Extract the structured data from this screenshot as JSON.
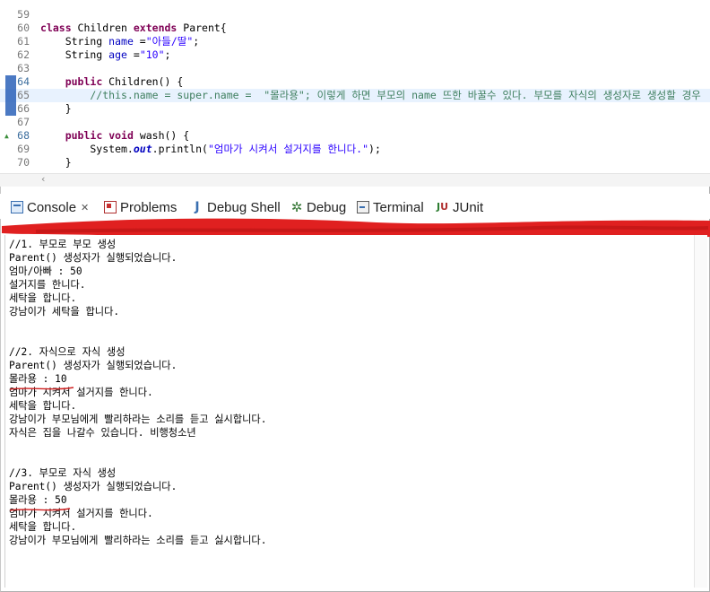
{
  "editor": {
    "lines": [
      {
        "num": "59",
        "tokens": []
      },
      {
        "num": "60",
        "tokens": [
          {
            "t": "kw",
            "v": "class"
          },
          {
            "t": "p",
            "v": " Children "
          },
          {
            "t": "kw",
            "v": "extends"
          },
          {
            "t": "p",
            "v": " Parent{"
          }
        ]
      },
      {
        "num": "61",
        "tokens": [
          {
            "t": "p",
            "v": "    String "
          },
          {
            "t": "fld",
            "v": "name"
          },
          {
            "t": "p",
            "v": " ="
          },
          {
            "t": "str",
            "v": "\"아들/딸\""
          },
          {
            "t": "p",
            "v": ";"
          }
        ]
      },
      {
        "num": "62",
        "tokens": [
          {
            "t": "p",
            "v": "    String "
          },
          {
            "t": "fld",
            "v": "age"
          },
          {
            "t": "p",
            "v": " ="
          },
          {
            "t": "str",
            "v": "\"10\""
          },
          {
            "t": "p",
            "v": ";"
          }
        ]
      },
      {
        "num": "63",
        "tokens": []
      },
      {
        "num": "64",
        "marker": "fold",
        "tokens": [
          {
            "t": "p",
            "v": "    "
          },
          {
            "t": "kw",
            "v": "public"
          },
          {
            "t": "p",
            "v": " Children() {"
          }
        ]
      },
      {
        "num": "65",
        "current": true,
        "tokens": [
          {
            "t": "cmt",
            "v": "        //this.name = super.name =  \"몰라용\"; 이렇게 하면 부모의 name 뜨한 바꿀수 있다. 부모를 자식의 생성자로 생성할 경우"
          }
        ]
      },
      {
        "num": "66",
        "tokens": [
          {
            "t": "p",
            "v": "    }"
          }
        ]
      },
      {
        "num": "67",
        "tokens": []
      },
      {
        "num": "68",
        "marker": "override",
        "tokens": [
          {
            "t": "p",
            "v": "    "
          },
          {
            "t": "kw",
            "v": "public"
          },
          {
            "t": "p",
            "v": " "
          },
          {
            "t": "kw",
            "v": "void"
          },
          {
            "t": "p",
            "v": " wash() {"
          }
        ]
      },
      {
        "num": "69",
        "tokens": [
          {
            "t": "p",
            "v": "        System."
          },
          {
            "t": "stat",
            "v": "out"
          },
          {
            "t": "p",
            "v": ".println("
          },
          {
            "t": "str",
            "v": "\"엄마가 시켜서 설거지를 한니다.\""
          },
          {
            "t": "p",
            "v": ");"
          }
        ]
      },
      {
        "num": "70",
        "tokens": [
          {
            "t": "p",
            "v": "    }"
          }
        ]
      }
    ]
  },
  "tabs": [
    {
      "label": "Console",
      "icon": "console-icon",
      "active": true,
      "close": "✕"
    },
    {
      "label": "Problems",
      "icon": "problems-icon"
    },
    {
      "label": "Debug Shell",
      "icon": "debug-shell-icon"
    },
    {
      "label": "Debug",
      "icon": "debug-icon"
    },
    {
      "label": "Terminal",
      "icon": "terminal-icon"
    },
    {
      "label": "JUnit",
      "icon": "junit-icon"
    }
  ],
  "console": {
    "lines": [
      "//1. 부모로 부모 생성",
      "Parent() 생성자가 실행되었습니다.",
      "엄마/아빠 : 50",
      "설거지를 한니다.",
      "세탁을 합니다.",
      "강남이가 세탁을 합니다.",
      "",
      "",
      "//2. 자식으로 자식 생성",
      "Parent() 생성자가 실행되었습니다.",
      "몰라용 : 10",
      "엄마가 시켜서 설거지를 한니다.",
      "세탁을 합니다.",
      "강남이가 부모님에게 빨리하라는 소리를 듣고 싫시합니다.",
      "자식은 집을 나갈수 있습니다. 비행청소년",
      "",
      "",
      "//3. 부모로 자식 생성",
      "Parent() 생성자가 실행되었습니다.",
      "몰라용 : 50",
      "엄마가 시켜서 설거지를 한니다.",
      "세탁을 합니다.",
      "강남이가 부모님에게 빨리하라는 소리를 듣고 싫시합니다."
    ]
  },
  "colors": {
    "keyword": "#7f0055",
    "string": "#2a00ff",
    "comment": "#3f7f5f",
    "field": "#0000c0",
    "redact": "#e02020"
  }
}
